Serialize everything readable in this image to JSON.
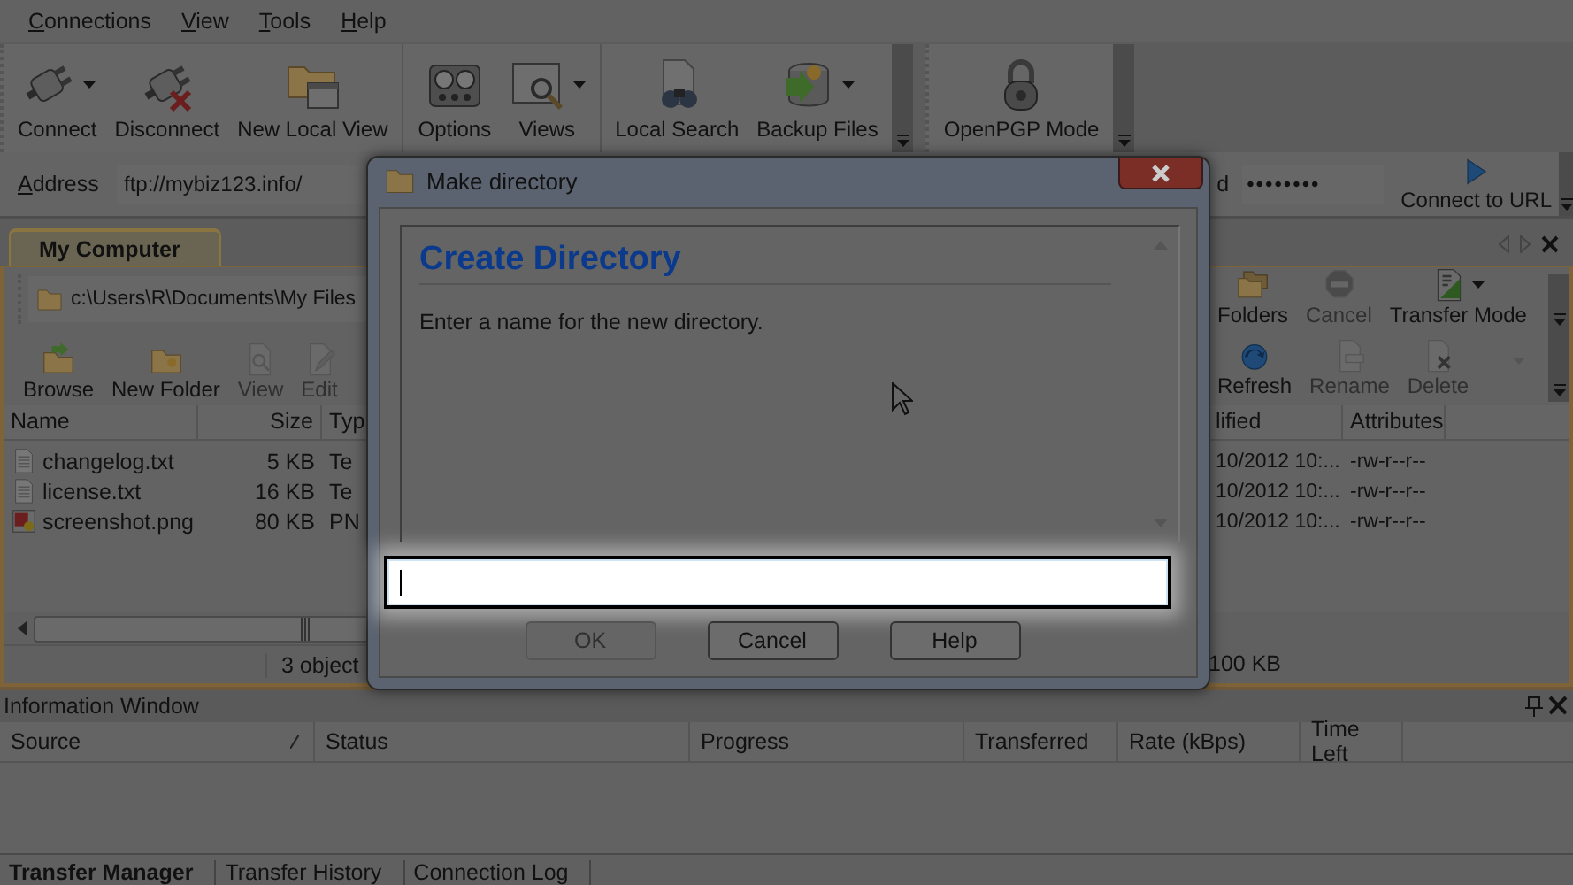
{
  "menu": [
    {
      "label": "Connections"
    },
    {
      "label": "View"
    },
    {
      "label": "Tools"
    },
    {
      "label": "Help"
    }
  ],
  "toolbars": [
    {
      "groups": [
        [
          {
            "label": "Connect",
            "dropdown": true
          },
          {
            "label": "Disconnect",
            "dropdown": false
          },
          {
            "label": "New Local View",
            "dropdown": false
          }
        ],
        [
          {
            "label": "Options",
            "dropdown": false
          },
          {
            "label": "Views",
            "dropdown": true
          }
        ],
        [
          {
            "label": "Local Search",
            "dropdown": false
          },
          {
            "label": "Backup Files",
            "dropdown": true
          }
        ]
      ]
    },
    {
      "groups": [
        [
          {
            "label": "OpenPGP Mode",
            "dropdown": false
          }
        ]
      ]
    }
  ],
  "address": {
    "label": "Address",
    "value": "ftp://mybiz123.info/",
    "password_label": "d",
    "password": "••••••••",
    "connect": "Connect to URL"
  },
  "tabs": [
    {
      "label": "My Computer",
      "selected": true
    }
  ],
  "local_panel": {
    "path": "c:\\Users\\R\\Documents\\My Files",
    "left_tools": [
      {
        "label": "Browse",
        "disabled": false
      },
      {
        "label": "New Folder",
        "disabled": false
      },
      {
        "label": "View",
        "disabled": true
      },
      {
        "label": "Edit",
        "disabled": true
      }
    ],
    "right_tools_top": [
      {
        "label": "Folders",
        "disabled": false,
        "dropdown": false
      },
      {
        "label": "Cancel",
        "disabled": true,
        "dropdown": false
      },
      {
        "label": "Transfer Mode",
        "disabled": false,
        "dropdown": true
      }
    ],
    "right_tools_bottom": [
      {
        "label": "Refresh",
        "disabled": false
      },
      {
        "label": "Rename",
        "disabled": true
      },
      {
        "label": "Delete",
        "disabled": true
      }
    ],
    "columns": [
      "Name",
      "Size",
      "Typ",
      "lified",
      "Attributes"
    ],
    "rows": [
      {
        "kind": "text",
        "cells": [
          "changelog.txt",
          "5 KB",
          "Te",
          "10/2012 10:...",
          "-rw-r--r--"
        ]
      },
      {
        "kind": "text",
        "cells": [
          "license.txt",
          "16 KB",
          "Te",
          "10/2012 10:...",
          "-rw-r--r--"
        ]
      },
      {
        "kind": "image",
        "cells": [
          "screenshot.png",
          "80 KB",
          "PN",
          "10/2012 10:...",
          "-rw-r--r--"
        ]
      }
    ],
    "status": [
      "3 object",
      "100 KB"
    ]
  },
  "dialog": {
    "title": "Make directory",
    "heading": "Create Directory",
    "prompt": "Enter a name for the new directory.",
    "buttons": [
      {
        "label": "OK",
        "disabled": true
      },
      {
        "label": "Cancel",
        "disabled": false
      },
      {
        "label": "Help",
        "disabled": false
      }
    ]
  },
  "info_window": {
    "title": "Information Window",
    "columns": [
      "Source",
      "Status",
      "Progress",
      "Transferred",
      "Rate (kBps)",
      "Time Left"
    ],
    "tabs": [
      {
        "label": "Transfer Manager",
        "selected": true
      },
      {
        "label": "Transfer History",
        "selected": false
      },
      {
        "label": "Connection Log",
        "selected": false
      }
    ]
  }
}
